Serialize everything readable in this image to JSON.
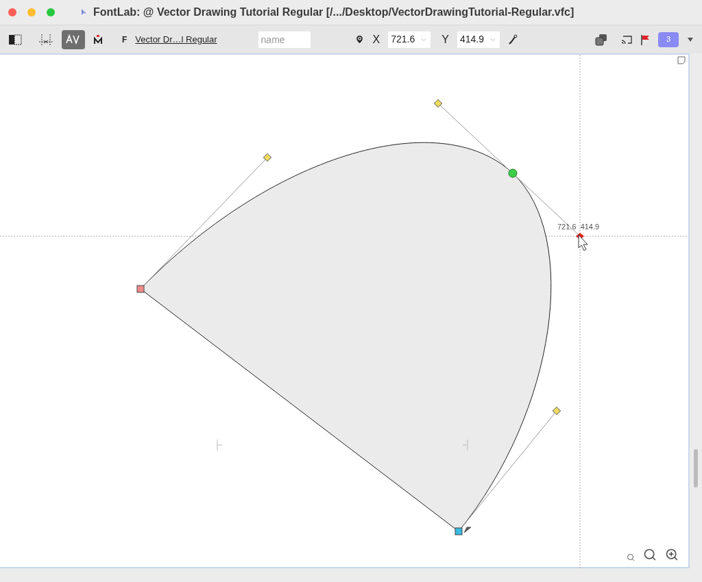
{
  "window": {
    "title": "FontLab:  @ Vector Drawing Tutorial Regular [/.../Desktop/VectorDrawingTutorial-Regular.vfc]"
  },
  "toolbar": {
    "font_name": "Vector Dr…l Regular",
    "font_prefix": "F",
    "name_field": {
      "placeholder": "name"
    },
    "x_label": "X",
    "x_value": "721.6",
    "y_label": "Y",
    "y_value": "414.9",
    "kerning_selected": true,
    "badge": "3"
  },
  "canvas": {
    "coordinate_readout": "721.6  414.9"
  }
}
